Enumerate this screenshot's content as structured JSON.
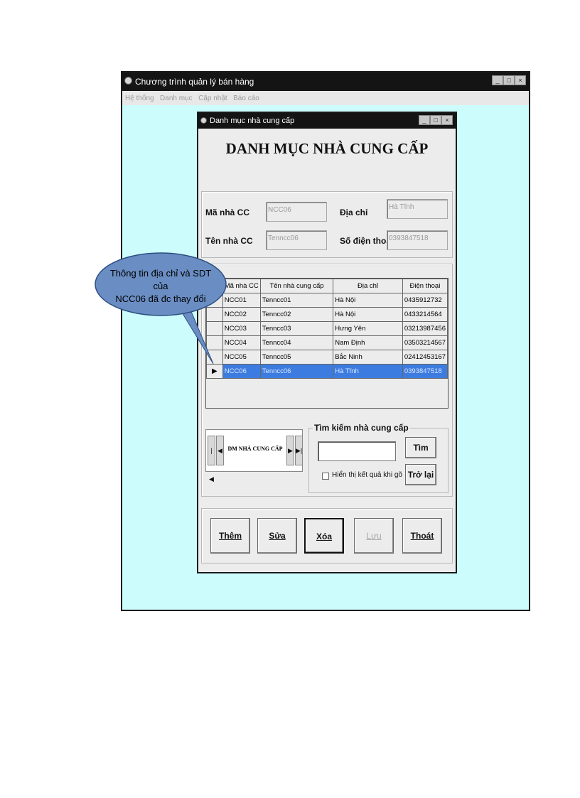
{
  "app": {
    "title": "Chương trình quản lý bán hàng",
    "menu": [
      "Hệ thống",
      "Danh mục",
      "Cập nhật",
      "Báo cáo"
    ]
  },
  "child": {
    "title": "Danh mục nhà cung cấp",
    "heading": "DANH MỤC NHÀ CUNG CẤP"
  },
  "form": {
    "ma_label": "Mã nhà CC",
    "ma_value": "NCC06",
    "ten_label": "Tên nhà CC",
    "ten_value": "Tenncc06",
    "diachi_label": "Địa chỉ",
    "diachi_value": "Hà Tĩnh",
    "sdt_label": "Số điện thoại",
    "sdt_value": "0393847518"
  },
  "grid": {
    "columns": [
      "Mã nhà CC",
      "Tên nhà cung cấp",
      "Địa chỉ",
      "Điện thoại"
    ],
    "rows": [
      [
        "NCC01",
        "Tenncc01",
        "Hà Nội",
        "0435912732"
      ],
      [
        "NCC02",
        "Tenncc02",
        "Hà Nội",
        "0433214564"
      ],
      [
        "NCC03",
        "Tenncc03",
        "Hưng Yên",
        "03213987456"
      ],
      [
        "NCC04",
        "Tenncc04",
        "Nam Định",
        "03503214567"
      ],
      [
        "NCC05",
        "Tenncc05",
        "Bắc Ninh",
        "02412453167"
      ],
      [
        "NCC06",
        "Tenncc06",
        "Hà Tĩnh",
        "0393847518"
      ]
    ],
    "selected_row": 5
  },
  "nav": {
    "label": "DM NHÀ CUNG CẤP",
    "first": "|◀",
    "prev": "◀",
    "next": "▶",
    "last": "▶|"
  },
  "search": {
    "legend": "Tìm kiếm nhà cung cấp",
    "input_value": "",
    "find_button": "Tìm",
    "back_button": "Trở lại",
    "checkbox_label": "Hiển thị kết quả khi gõ",
    "checkbox_checked": false
  },
  "buttons": {
    "them": "Thêm",
    "sua": "Sửa",
    "xoa": "Xóa",
    "luu": "Lưu",
    "thoat": "Thoát"
  },
  "callout": {
    "line1": "Thông tin địa chỉ và SDT của",
    "line2": "NCC06 đã đc thay đổi"
  },
  "colors": {
    "app_background": "#ccfcfc",
    "title_bar": "#141414",
    "selected_row": "#3c7ce0",
    "callout_fill": "#6a8ec4"
  }
}
